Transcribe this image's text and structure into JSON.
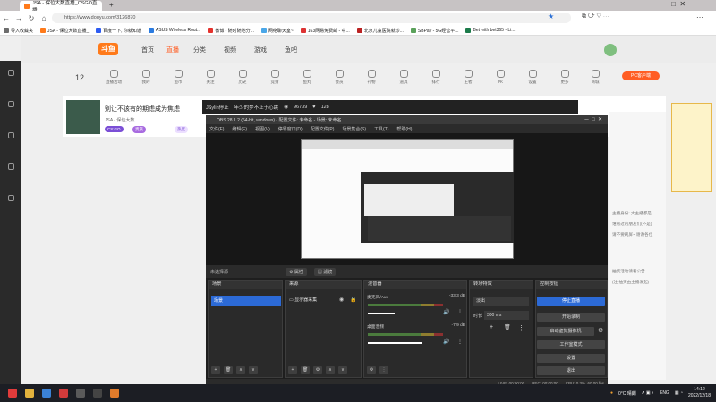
{
  "browser": {
    "tabs": [
      {
        "label": "JSA - 保位大数直播_CSGO直播",
        "active": true
      }
    ],
    "new_tab": "+",
    "url": "https://www.douyu.com/3126870"
  },
  "bookmarks": [
    "导入收藏夹",
    "JSA - 保位大数直播_",
    "百度一下, 你就知道",
    "ASUS Wireless Rout...",
    "微博 - 随时随地分...",
    "网络聊天室~",
    "163网易免费邮 - 中...",
    "北京儿童医院就诊...",
    "SBPay - 5G经营平...",
    "Bet with bet365 - Li..."
  ],
  "site": {
    "logo": "斗鱼",
    "nav": [
      "首页",
      "直播",
      "分类",
      "视频",
      "游戏",
      "鱼吧"
    ],
    "pc_client": "PC客户端",
    "categories": [
      "公会列表",
      "直播活动",
      "我的",
      "鱼币",
      "关注",
      "历史",
      "竞猜",
      "鱼丸",
      "会员",
      "礼物",
      "道具",
      "排行",
      "王者",
      "PK",
      "设置",
      "更多",
      "商城",
      "守护",
      "金币",
      "…"
    ],
    "follow_count": "12",
    "room": {
      "title": "别让不该有的期虑成为焦虑",
      "streamer": "JSA - 保位大数",
      "tag": "CS:GO",
      "fans": "贵族",
      "rank": "热度"
    },
    "player": {
      "room_name": "JSylin停止",
      "note": "年少的梦不止于心跳",
      "views": "96739",
      "likes": "128"
    },
    "right_text": [
      "主播身份: 大主播都是",
      "谁看过的朋友们(不是)",
      "请不要刷屏~ 谢谢各位",
      "抽奖活动请看公告",
      "(注:抽奖由主播发起)"
    ]
  },
  "obs": {
    "title": "OBS 28.1.2 (64-bit, windows) - 配置文件: 未命名 - 场景: 未命名",
    "menu": [
      "文件(F)",
      "编辑(E)",
      "视图(V)",
      "停靠窗口(D)",
      "配置文件(P)",
      "场景集合(S)",
      "工具(T)",
      "帮助(H)"
    ],
    "no_source": "未选择源",
    "properties": "属性",
    "filters": "滤镜",
    "docks": {
      "scenes": "场景",
      "sources": "来源",
      "mixer": "混音器",
      "transitions": "转场特效",
      "controls": "控制按钮"
    },
    "scene_item": "场景",
    "source_item": "显示器采集",
    "mixer": [
      {
        "name": "麦克风/Aux",
        "db": "-33.3 dB"
      },
      {
        "name": "桌面音频",
        "db": "-7.9 dB"
      }
    ],
    "transition": {
      "type": "淡出",
      "duration_label": "时长",
      "duration": "300 ms"
    },
    "controls": [
      "停止直播",
      "开始录制",
      "启动虚拟摄像机",
      "工作室模式",
      "设置",
      "退出"
    ],
    "status": {
      "live": "LIVE: 00:00:00",
      "rec": "REC: 00:00:00",
      "cpu": "CPU: 0.3%, 60.00 fps"
    }
  },
  "taskbar": {
    "weather": "0°C 晴朗",
    "lang": "ENG",
    "time": "14:12",
    "date": "2022/12/18"
  }
}
